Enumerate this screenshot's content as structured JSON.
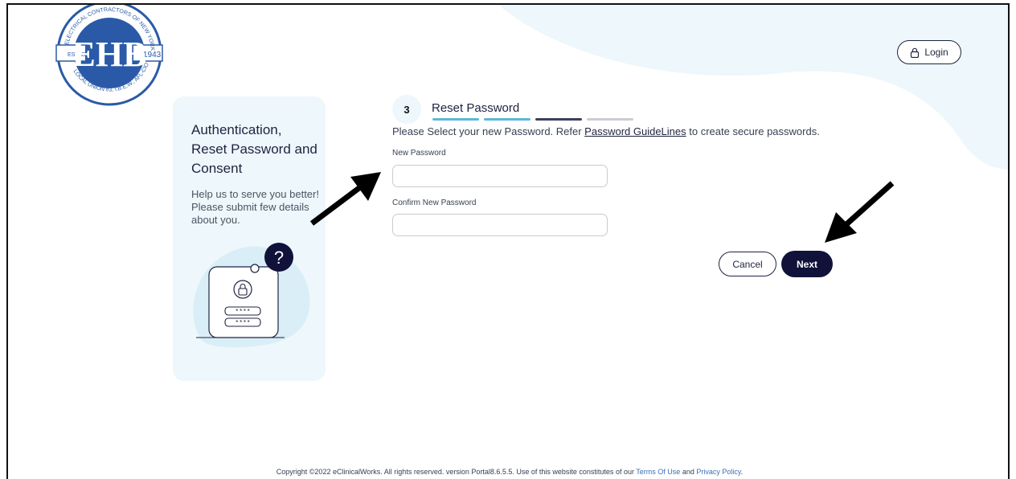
{
  "header": {
    "logo": {
      "top_text": "ELECTRICAL CONTRACTORS OF NEW YORK",
      "bottom_text": "LOCAL UNION #3, I.B.E.W., AFL-CIO",
      "left_text": "ESTABLISHED",
      "right_text": "1943",
      "monogram": "EHB"
    },
    "login_label": "Login",
    "login_icon": "lock-icon"
  },
  "side_panel": {
    "title": "Authentication, Reset Password and Consent",
    "description": "Help us to serve you better! Please submit few details about you.",
    "question_mark": "?",
    "password_mask_1": "****",
    "password_mask_2": "****"
  },
  "step": {
    "number": "3",
    "title": "Reset Password",
    "progress_colors": [
      "#5bb8d6",
      "#5bb8d6",
      "#3d3f5c",
      "#c9cdd3"
    ]
  },
  "instructions": {
    "prefix": "Please Select your new Password. Refer ",
    "link": "Password GuideLines",
    "suffix": " to create secure passwords."
  },
  "form": {
    "new_password_label": "New Password",
    "new_password_value": "",
    "confirm_password_label": "Confirm New Password",
    "confirm_password_value": ""
  },
  "actions": {
    "cancel_label": "Cancel",
    "next_label": "Next"
  },
  "footer": {
    "text": "Copyright ©2022 eClinicalWorks. All rights reserved. version  Portal8.6.5.5.  Use of this website constitutes of our ",
    "terms": "Terms Of Use",
    "and": " and ",
    "privacy": "Privacy Policy",
    "end": "."
  },
  "colors": {
    "primary": "#10123a",
    "accent": "#5bb8d6",
    "panel": "#eef7fb"
  }
}
